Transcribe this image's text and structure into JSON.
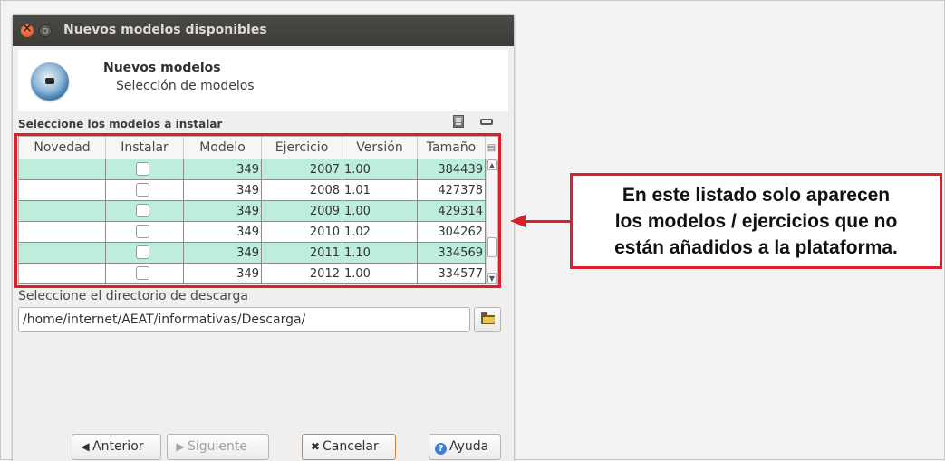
{
  "window": {
    "title": "Nuevos modelos disponibles"
  },
  "header": {
    "title": "Nuevos modelos",
    "subtitle": "Selección de modelos"
  },
  "section_label": "Seleccione los modelos a instalar",
  "table": {
    "columns": [
      "Novedad",
      "Instalar",
      "Modelo",
      "Ejercicio",
      "Versión",
      "Tamaño"
    ],
    "rows": [
      {
        "novedad": "",
        "instalar": false,
        "modelo": "349",
        "ejercicio": "2007",
        "version": "1.00",
        "tamano": "384439",
        "highlight": true
      },
      {
        "novedad": "",
        "instalar": false,
        "modelo": "349",
        "ejercicio": "2008",
        "version": "1.01",
        "tamano": "427378",
        "highlight": false
      },
      {
        "novedad": "",
        "instalar": false,
        "modelo": "349",
        "ejercicio": "2009",
        "version": "1.00",
        "tamano": "429314",
        "highlight": true
      },
      {
        "novedad": "",
        "instalar": false,
        "modelo": "349",
        "ejercicio": "2010",
        "version": "1.02",
        "tamano": "304262",
        "highlight": false
      },
      {
        "novedad": "",
        "instalar": false,
        "modelo": "349",
        "ejercicio": "2011",
        "version": "1.10",
        "tamano": "334569",
        "highlight": true
      },
      {
        "novedad": "",
        "instalar": false,
        "modelo": "349",
        "ejercicio": "2012",
        "version": "1.00",
        "tamano": "334577",
        "highlight": false
      }
    ]
  },
  "download": {
    "label": "Seleccione el directorio de descarga",
    "path": "/home/internet/AEAT/informativas/Descarga/"
  },
  "buttons": {
    "anterior": "Anterior",
    "siguiente": "Siguiente",
    "cancelar": "Cancelar",
    "ayuda": "Ayuda"
  },
  "annotation": {
    "lines": [
      "En este listado solo aparecen",
      "los modelos / ejercicios que no",
      "están añadidos a la plataforma."
    ]
  },
  "colors": {
    "row_highlight": "#bdeedb",
    "annotation_red": "#d9202d",
    "titlebar": "#3c3b37"
  }
}
